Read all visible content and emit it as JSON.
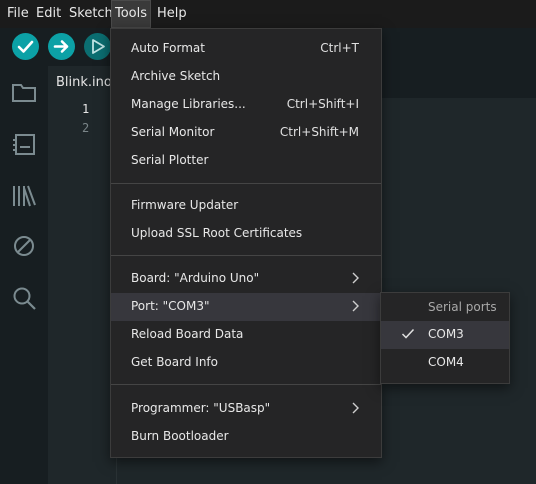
{
  "menubar": {
    "items": [
      {
        "label": "File"
      },
      {
        "label": "Edit"
      },
      {
        "label": "Sketch"
      },
      {
        "label": "Tools"
      },
      {
        "label": "Help"
      }
    ]
  },
  "editor": {
    "tab_label": "Blink.ino",
    "line_numbers": [
      "1",
      "2"
    ]
  },
  "tools_menu": {
    "items": [
      {
        "label": "Auto Format",
        "shortcut": "Ctrl+T"
      },
      {
        "label": "Archive Sketch"
      },
      {
        "label": "Manage Libraries...",
        "shortcut": "Ctrl+Shift+I"
      },
      {
        "label": "Serial Monitor",
        "shortcut": "Ctrl+Shift+M"
      },
      {
        "label": "Serial Plotter"
      },
      {
        "label": "Firmware Updater"
      },
      {
        "label": "Upload SSL Root Certificates"
      },
      {
        "label": "Board: \"Arduino Uno\""
      },
      {
        "label": "Port: \"COM3\""
      },
      {
        "label": "Reload Board Data"
      },
      {
        "label": "Get Board Info"
      },
      {
        "label": "Programmer: \"USBasp\""
      },
      {
        "label": "Burn Bootloader"
      }
    ]
  },
  "port_submenu": {
    "header": "Serial ports",
    "items": [
      {
        "label": "COM3",
        "selected": true
      },
      {
        "label": "COM4",
        "selected": false
      }
    ]
  },
  "colors": {
    "accent": "#0ca1a6",
    "menu_bg": "#252526",
    "highlight": "#37373d"
  },
  "icons": [
    "verify-icon",
    "upload-icon",
    "debug-icon",
    "folder-icon",
    "board-icon",
    "library-icon",
    "no-entry-icon",
    "search-icon",
    "chevron-right-icon",
    "checkmark-icon"
  ]
}
